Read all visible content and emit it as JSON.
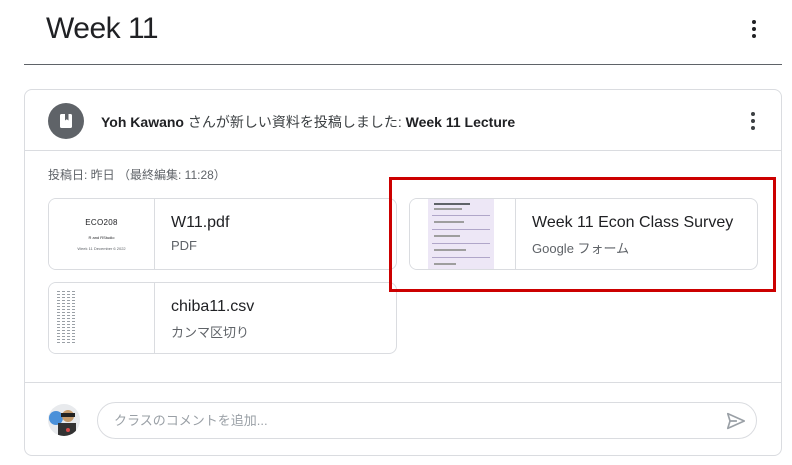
{
  "topic": {
    "title": "Week 11"
  },
  "post": {
    "author": "Yoh Kawano",
    "action": " さんが新しい資料を投稿しました: ",
    "material_title": "Week 11 Lecture",
    "date": "投稿日: 昨日 （最終編集: 11:28）",
    "icon": "material-book-icon"
  },
  "attachments": [
    {
      "title": "W11.pdf",
      "type": "PDF",
      "thumb": {
        "line1": "ECO208",
        "line2": "R and RStudio",
        "line3": "Week 11 December 6 2022"
      }
    },
    {
      "title": "Week 11 Econ Class Survey",
      "type": "Google フォーム"
    },
    {
      "title": "chiba11.csv",
      "type": "カンマ区切り"
    }
  ],
  "comment": {
    "placeholder": "クラスのコメントを追加..."
  },
  "colors": {
    "highlight": "#cc0000",
    "avatar_bg": "#5f6368",
    "form_thumb": "#ede7f6"
  }
}
